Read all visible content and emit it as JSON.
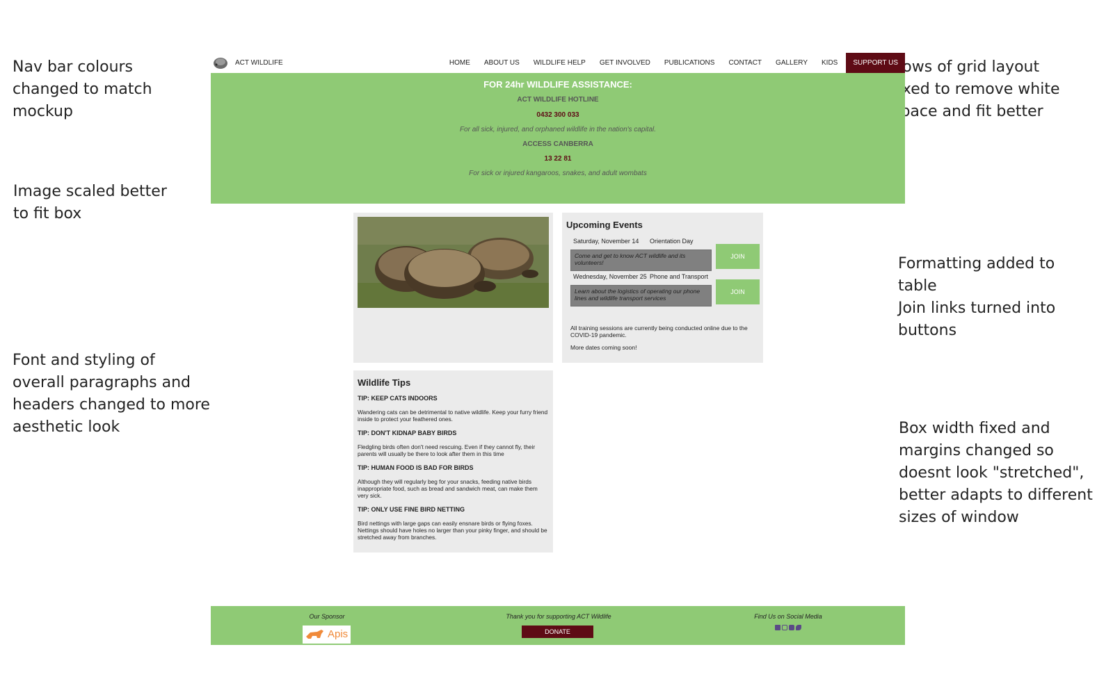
{
  "annotations": [
    "Nav bar colours changed to match mockup",
    "Image scaled better to fit box",
    "Font and styling of overall paragraphs and headers changed to more aesthetic look",
    "Rows of grid layout fixed to remove white space and fit better",
    "Formatting added to table\nJoin links turned into buttons",
    "Box width fixed and margins changed so doesnt look \"stretched\", better adapts to different sizes of window"
  ],
  "nav": {
    "brand": "ACT WILDLIFE",
    "items": [
      "HOME",
      "ABOUT US",
      "WILDLIFE HELP",
      "GET INVOLVED",
      "PUBLICATIONS",
      "CONTACT",
      "GALLERY",
      "KIDS"
    ],
    "support": "SUPPORT US"
  },
  "hero": {
    "title": "FOR 24hr WILDLIFE ASSISTANCE:",
    "hotline_label": "ACT WILDLIFE HOTLINE",
    "hotline_phone": "0432 300 033",
    "hotline_note": "For all sick, injured, and orphaned wildlife in the nation's capital.",
    "access_label": "ACCESS CANBERRA",
    "access_phone": "13 22 81",
    "access_note": "For sick or injured kangaroos, snakes, and adult wombats"
  },
  "events": {
    "title": "Upcoming Events",
    "items": [
      {
        "date": "Saturday, November 14",
        "name": "Orientation Day",
        "desc": "Come and get to know ACT wildlife and its volunteers!",
        "button": "JOIN"
      },
      {
        "date": "Wednesday, November 25",
        "name": "Phone and Transport",
        "desc": "Learn about the logistics of operating our phone lines and wildlife transport services",
        "button": "JOIN"
      }
    ],
    "note1": "All training sessions are currently being conducted online due to the COVID-19 pandemic.",
    "note2": "More dates coming soon!"
  },
  "tips": {
    "title": "Wildlife Tips",
    "items": [
      {
        "heading": "TIP: KEEP CATS INDOORS",
        "text": "Wandering cats can be detrimental to native wildlife. Keep your furry friend inside to protect your feathered ones."
      },
      {
        "heading": "TIP: DON'T KIDNAP BABY BIRDS",
        "text": "Fledgling birds often don't need rescuing. Even if they cannot fly, their parents will usually be there to look after them in this time"
      },
      {
        "heading": "TIP: HUMAN FOOD IS BAD FOR BIRDS",
        "text": "Although they will regularly beg for your snacks, feeding native birds inappropriate food, such as bread and sandwich meat, can make them very sick."
      },
      {
        "heading": "TIP: ONLY USE FINE BIRD NETTING",
        "text": "Bird nettings with large gaps can easily ensnare birds or flying foxes. Nettings should have holes no larger than your pinky finger, and should be stretched away from branches."
      }
    ]
  },
  "footer": {
    "sponsor_label": "Our Sponsor",
    "sponsor_name": "Apis",
    "thanks": "Thank you for supporting ACT Wildlife",
    "donate": "DONATE",
    "social_label": "Find Us on Social Media",
    "social_icons": [
      "facebook-icon",
      "instagram-icon",
      "youtube-icon",
      "twitter-icon"
    ]
  },
  "colors": {
    "green": "#8fca75",
    "maroon": "#5e0b15",
    "card_bg": "#ebebeb",
    "event_desc_bg": "#808080"
  }
}
